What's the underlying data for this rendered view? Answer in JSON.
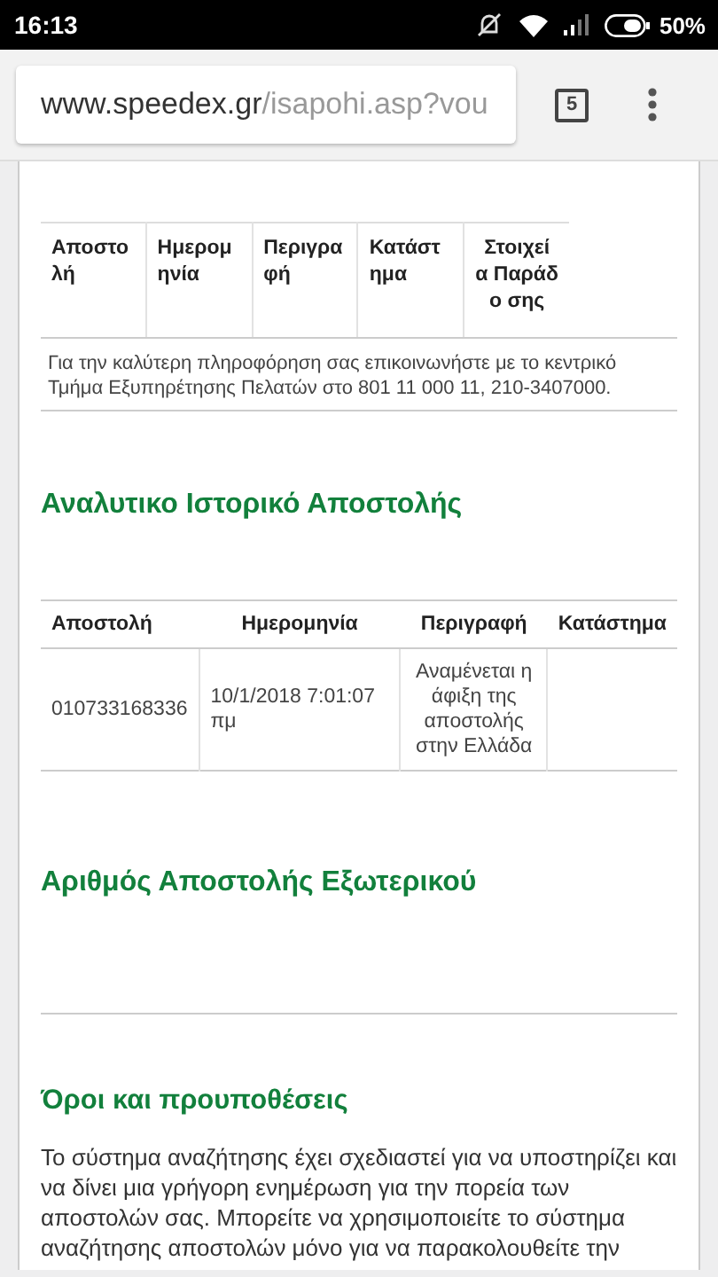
{
  "status_bar": {
    "time": "16:13",
    "battery": "50%"
  },
  "browser": {
    "url_host": "www.speedex.gr",
    "url_path": "/isapohi.asp?vou",
    "tab_count": "5"
  },
  "delivery_table": {
    "columns": [
      "Αποστο λή",
      "Ημερομ ηνία",
      "Περιγρα φή",
      "Κατάστ ημα",
      "Στοιχεί α Παράδο σης"
    ],
    "note": "Για την καλύτερη πληροφόρηση σας επικοινωνήστε με το κεντρικό Τμήμα Εξυπηρέτησης Πελατών στο 801 11 000 11, 210-3407000."
  },
  "history": {
    "title": "Αναλυτικο Ιστορικό Αποστολής",
    "columns": [
      "Αποστολή",
      "Ημερομηνία",
      "Περιγραφή",
      "Κατάστημα"
    ],
    "rows": [
      {
        "cells": [
          "010733168336",
          "10/1/2018 7:01:07 πμ",
          "Αναμένεται η άφιξη της αποστολής στην Ελλάδα",
          ""
        ]
      }
    ]
  },
  "foreign": {
    "title": "Αριθμός Αποστολής Εξωτερικού"
  },
  "terms": {
    "title": "Όροι και προυποθέσεις",
    "text": "Το σύστημα αναζήτησης έχει σχεδιαστεί για να υποστηρίζει και να δίνει μια γρήγορη ενημέρωση για την πορεία των αποστολών σας. Μπορείτε να χρησιμοποιείτε το σύστημα αναζήτησης αποστολών μόνο για να παρακολουθείτε την"
  }
}
